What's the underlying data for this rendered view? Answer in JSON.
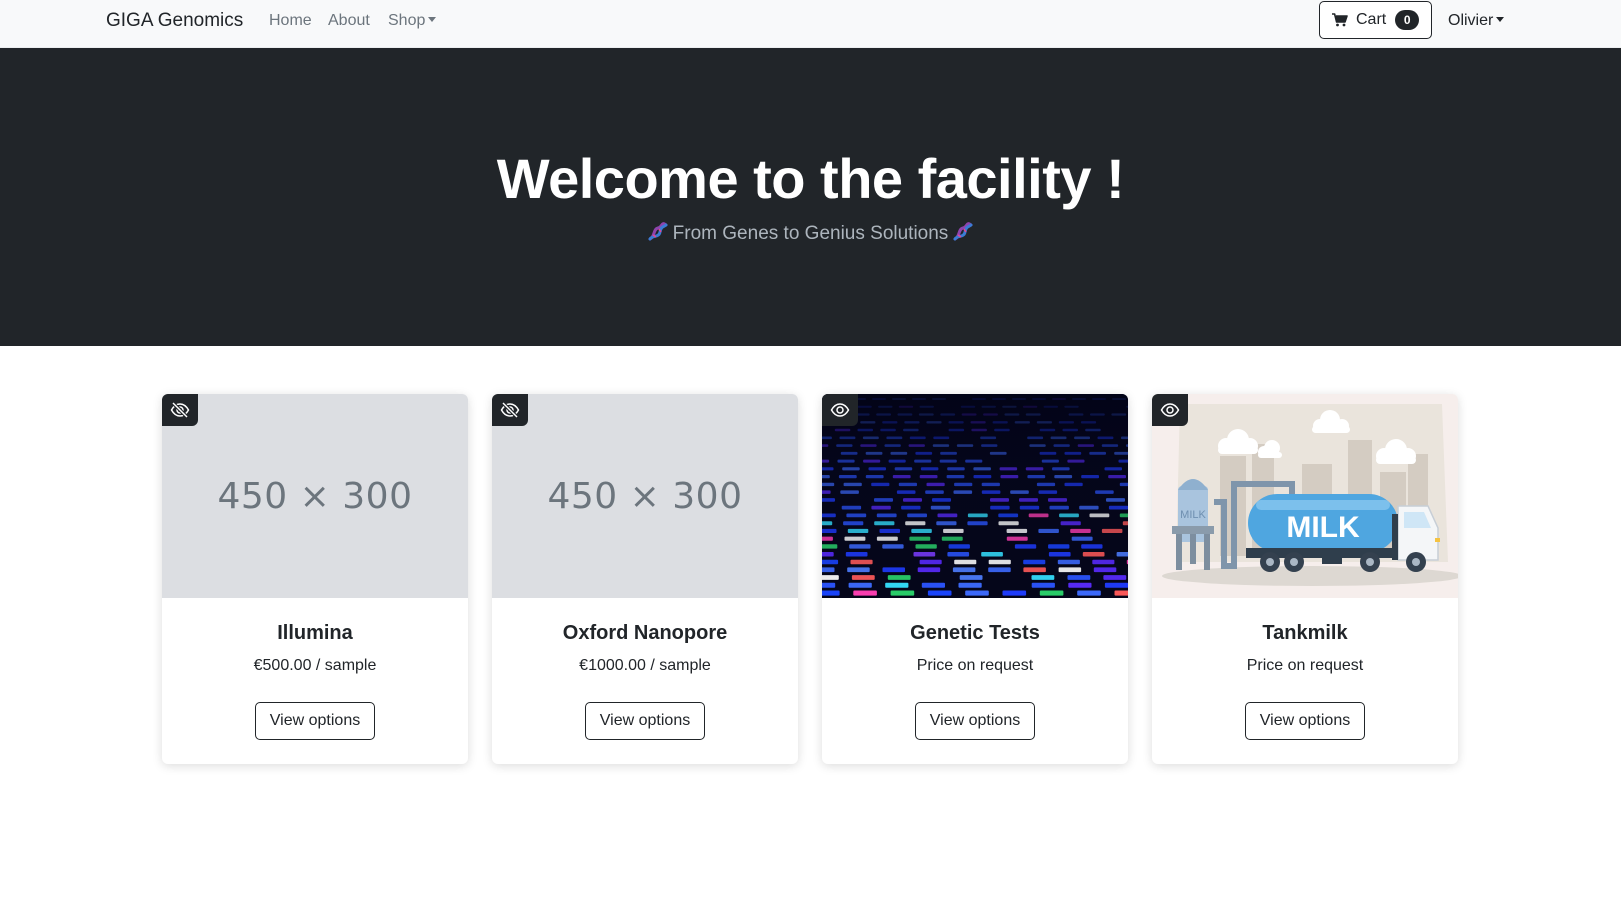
{
  "navbar": {
    "brand": "GIGA Genomics",
    "links": [
      {
        "label": "Home"
      },
      {
        "label": "About"
      },
      {
        "label": "Shop"
      }
    ],
    "cart": {
      "label": "Cart",
      "count": "0",
      "icon": "cart-icon"
    },
    "user": {
      "name": "Olivier"
    }
  },
  "hero": {
    "title": "Welcome to the facility !",
    "subtitle": "From Genes to Genius Solutions",
    "decoration_icon": "dna-icon"
  },
  "products": [
    {
      "title": "Illumina",
      "price": "€500.00 / sample",
      "button": "View options",
      "image": "placeholder",
      "placeholder_text": "450 × 300",
      "visibility_icon": "eye-slash-icon"
    },
    {
      "title": "Oxford Nanopore",
      "price": "€1000.00 / sample",
      "button": "View options",
      "image": "placeholder",
      "placeholder_text": "450 × 300",
      "visibility_icon": "eye-slash-icon"
    },
    {
      "title": "Genetic Tests",
      "price": "Price on request",
      "button": "View options",
      "image": "dna-sequencing-gel",
      "visibility_icon": "eye-icon"
    },
    {
      "title": "Tankmilk",
      "price": "Price on request",
      "button": "View options",
      "image": "milk-tanker-illustration",
      "visibility_icon": "eye-icon"
    }
  ],
  "colors": {
    "navbar_bg": "#f8f9fa",
    "hero_bg": "#212529",
    "hero_subtitle": "#adb5bd",
    "placeholder_bg": "#dcdee2",
    "accent_dark": "#212529"
  }
}
